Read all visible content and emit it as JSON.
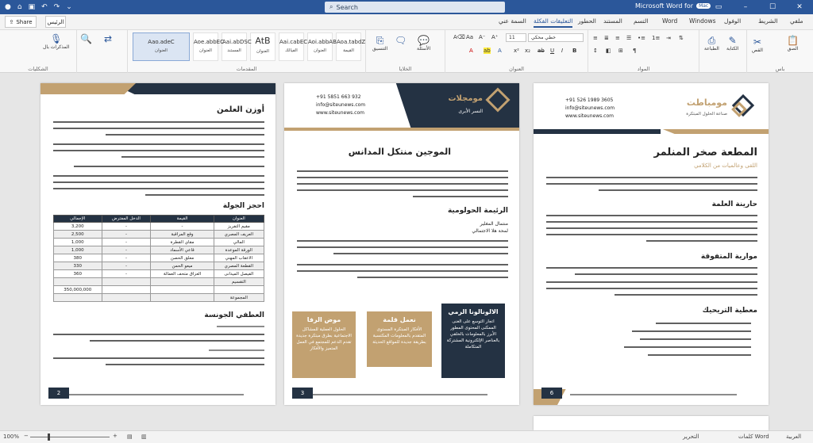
{
  "titlebar": {
    "search_placeholder": "Search",
    "app_title": "Microsoft Word for",
    "badge": "Mac"
  },
  "tabs": {
    "share": "Share",
    "comments": "الرئيس",
    "items": [
      "ملفي",
      "الشريط",
      "الوفول",
      "Windows",
      "Word",
      "التسم",
      "المستند",
      "الحطور",
      "التعليقات الفكلة",
      "السمة عني"
    ]
  },
  "ribbon": {
    "styles": [
      {
        "sample": "Aao.adeC",
        "name": "العنوان"
      },
      {
        "sample": "Aoe.abbEC",
        "name": "العنوان"
      },
      {
        "sample": "Aai.abDSC",
        "name": "المستند"
      },
      {
        "sample": "AtB",
        "name": "العنوان"
      },
      {
        "sample": "Aai.cabEC",
        "name": "الفيالك"
      },
      {
        "sample": "Aoi.abbAB",
        "name": "العنوان"
      },
      {
        "sample": "Aoa.tabdZ",
        "name": "القيمة"
      }
    ],
    "font_name": "خطي محكي",
    "font_size": "11",
    "groups": [
      "المقدمات",
      "الخلايا",
      "الأسئلة",
      "العنوان",
      "المواد",
      "باس"
    ],
    "left_labels": [
      "المذكرات بال",
      "الشكليات"
    ],
    "buttons": [
      "الصق",
      "القص",
      "الطباعة",
      "الكتابة",
      "التنسيق"
    ]
  },
  "pages": {
    "page_left": {
      "title": "أوزن العلمن",
      "heading2": "احجز الجولة",
      "heading3": "العطفي الجونسة",
      "page_number": "2",
      "table": {
        "headers": [
          "العنوان",
          "القيمة",
          "الدخل المفترض",
          "الإجمالي"
        ],
        "rows": [
          [
            "مقيم التفريز",
            "-",
            "-",
            "3,200"
          ],
          [
            "العريف المصري",
            "وقع المراقبة",
            "-",
            "2,500"
          ],
          [
            "المالي",
            "مقاي القطرة",
            "-",
            "1,000"
          ],
          [
            "الورقة الموعدة",
            "قاعي الأسماد",
            "-",
            "1,000"
          ],
          [
            "الاعقاب المهني",
            "معلق الحصن",
            "-",
            "380"
          ],
          [
            "القطعة المصري",
            "ميعو الحمن",
            "-",
            "330"
          ],
          [
            "الفيصل الميدانى",
            "العزاق متحف العمالة",
            "-",
            "360"
          ],
          [
            "التقسيم",
            "",
            "",
            ""
          ],
          [
            "",
            "",
            "",
            "350,000,000"
          ],
          [
            "المجموعة",
            "",
            "",
            ""
          ]
        ]
      }
    },
    "page_mid": {
      "brand": "مومجلات",
      "contact_phone": "+91 5851 663 932",
      "contact_email": "info@siteunews.com",
      "contact_web": "www.siteunews.com",
      "brand_alt": "النسر الأبرى",
      "title": "الموجين منتكل المدانس",
      "heading": "الرئيمة الحولومية",
      "label1": "منتمال المغلير",
      "label2": "لمحة هلا الاجتمالي",
      "page_number": "3",
      "cards": [
        {
          "title": "الالونالونا الرمي",
          "body": "اتجار التوسع على الغنى الممكنى المحتوى المطور الأبرز بالمعلومات بالخلقي بالعناصر الإلكترونية المشتركة المتكاملة"
        },
        {
          "title": "نعمل قلمة",
          "body": "الأفكار المبتكرة المستوى المتقدم بالمعلومات المكتسبة بطريقة جديدة للمواقع الحديثة"
        },
        {
          "title": "موض الرفا",
          "body": "الحلول العملية للمشاكل الاجتماعية بطرق مبتكرة جديدة تقدم الدعم للمجتمع في العمل المتميز والأفكار"
        }
      ]
    },
    "page_right": {
      "brand": "مومباطت",
      "brand_sub": "صناعة الحلول المبتكرة",
      "contact_phone": "+91 526 1989 3605",
      "contact_email": "info@siteunews.com",
      "contact_web": "www.siteunews.com",
      "title": "المطعة صخر المنلمر",
      "subtitle": "اللقى وعالميات من الكلامي",
      "heading1": "حارينة العلمة",
      "heading2": "موارية المتفوقة",
      "heading3": "معطية التريحيك",
      "page_number": "6"
    }
  },
  "status": {
    "zoom": "100%",
    "page_info": "الصفحة 3 من 4",
    "language": "العربية",
    "word_count": "كلمات Word",
    "mode": "التحرير"
  },
  "colors": {
    "ribbon_blue": "#2b579a",
    "navy": "#243243",
    "gold": "#c2a171"
  }
}
